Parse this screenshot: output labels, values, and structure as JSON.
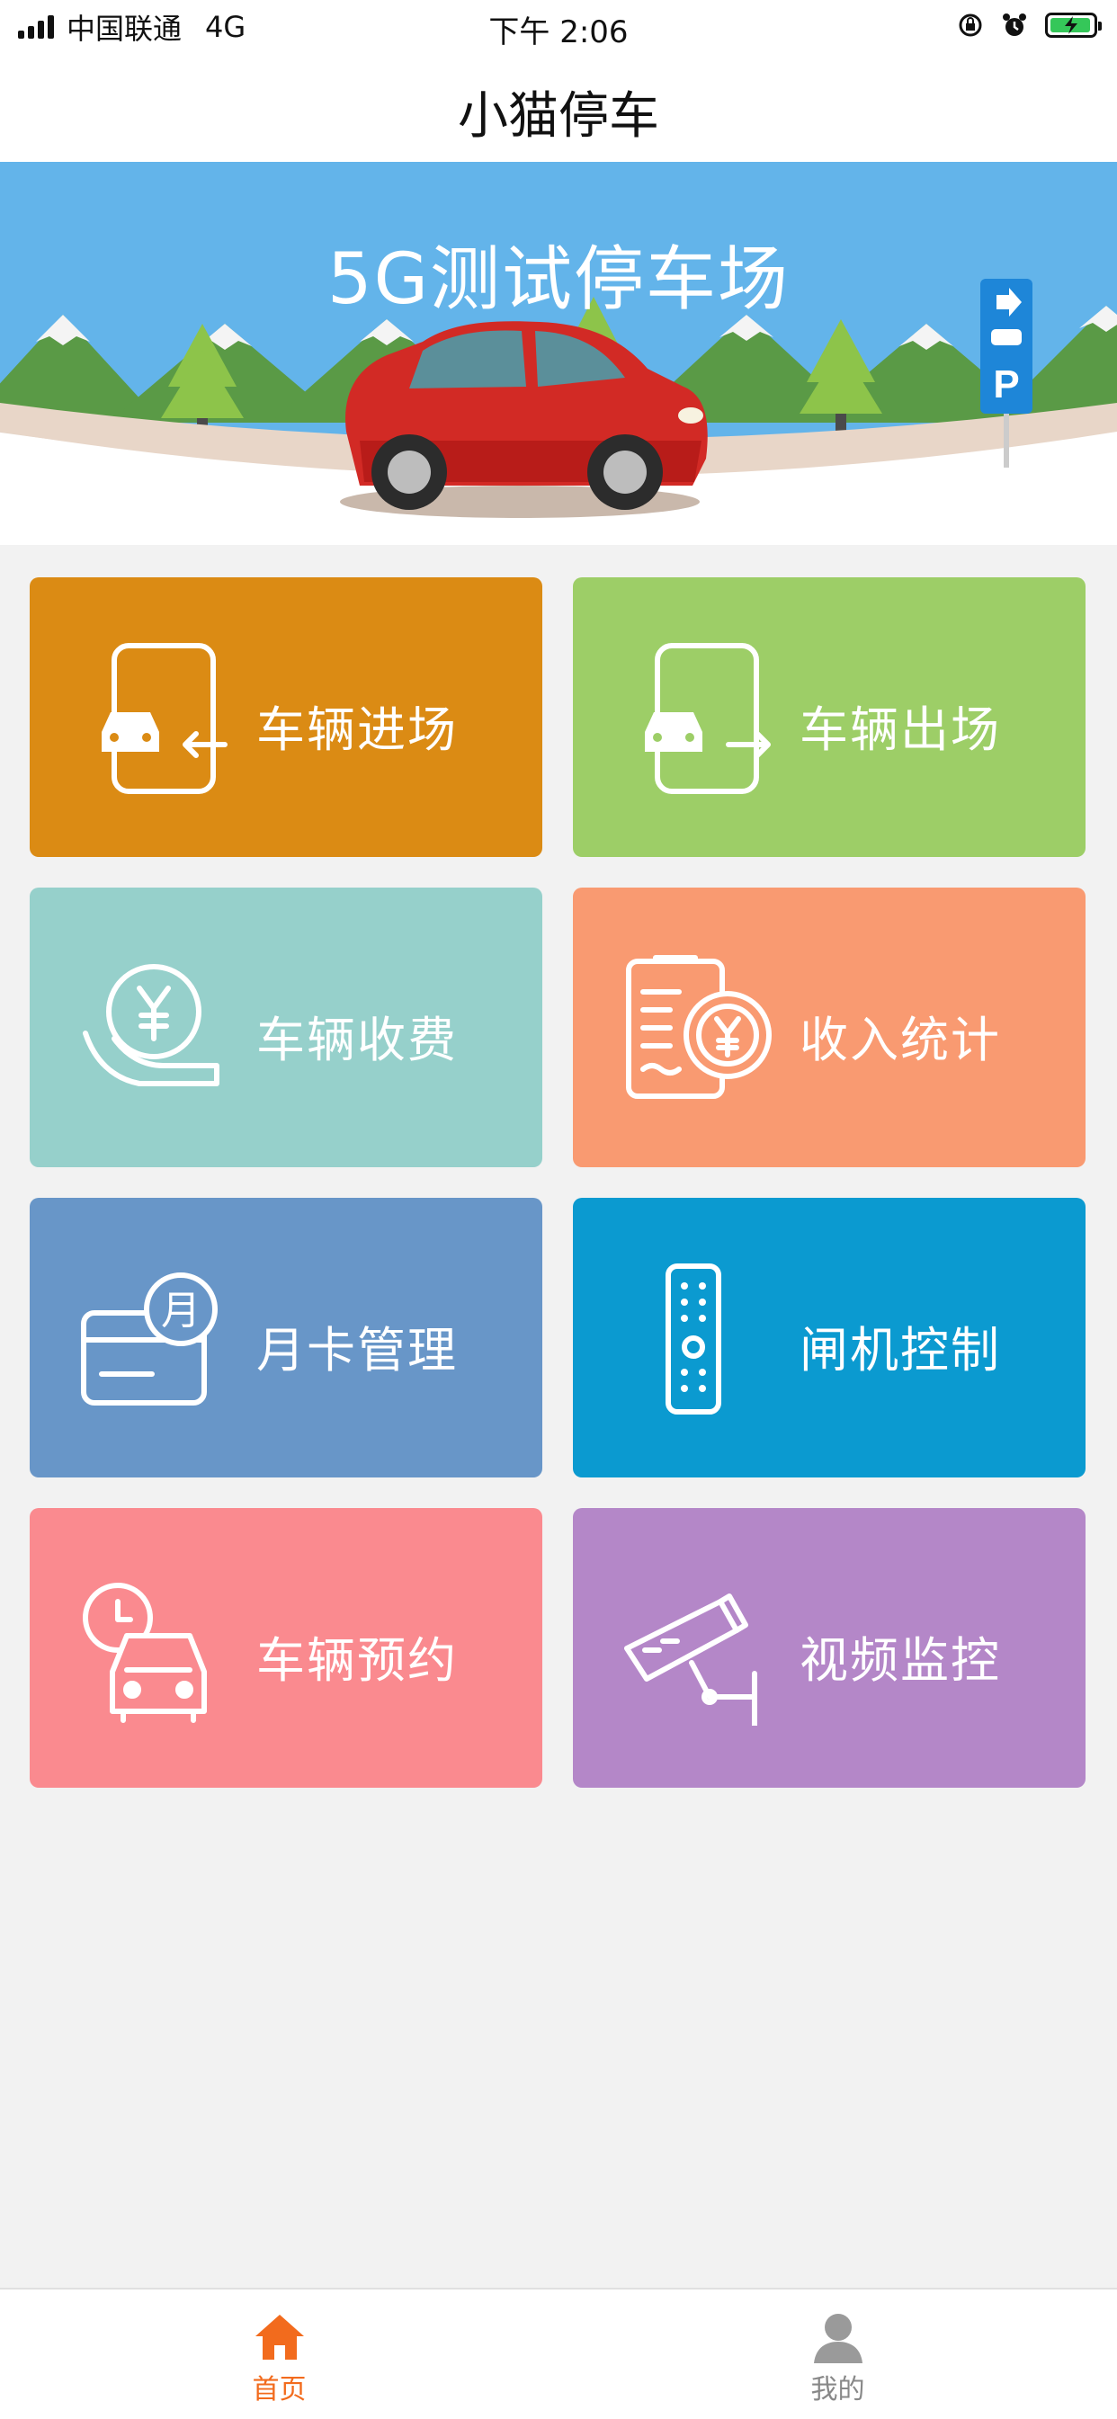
{
  "status_bar": {
    "carrier": "中国联通",
    "network": "4G",
    "time": "下午 2:06"
  },
  "navbar": {
    "title": "小猫停车"
  },
  "banner": {
    "title": "5G测试停车场"
  },
  "tiles": [
    {
      "label": "车辆进场",
      "color": "#db8b14",
      "icon": "car-entry-icon"
    },
    {
      "label": "车辆出场",
      "color": "#9dce67",
      "icon": "car-exit-icon"
    },
    {
      "label": "车辆收费",
      "color": "#96d0cb",
      "icon": "hand-coin-icon"
    },
    {
      "label": "收入统计",
      "color": "#f99a71",
      "icon": "receipt-coin-icon"
    },
    {
      "label": "月卡管理",
      "color": "#6896c8",
      "icon": "monthly-card-icon"
    },
    {
      "label": "闸机控制",
      "color": "#0b9ad0",
      "icon": "remote-control-icon"
    },
    {
      "label": "车辆预约",
      "color": "#fa8a8f",
      "icon": "car-clock-icon"
    },
    {
      "label": "视频监控",
      "color": "#b487c8",
      "icon": "cctv-camera-icon"
    }
  ],
  "tabbar": {
    "home": {
      "label": "首页",
      "color": "#f26b1d",
      "icon": "home-icon"
    },
    "mine": {
      "label": "我的",
      "color": "#888888",
      "icon": "person-icon"
    }
  }
}
